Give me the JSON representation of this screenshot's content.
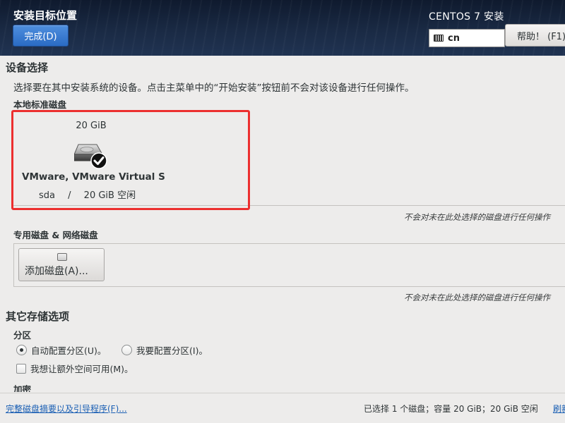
{
  "header": {
    "title": "安装目标位置",
    "done_label": "完成(D)",
    "product": "CENTOS 7 安装",
    "keyboard_layout": "cn",
    "help_label": "帮助！ (F1)"
  },
  "device_selection": {
    "heading": "设备选择",
    "description": "选择要在其中安装系统的设备。点击主菜单中的“开始安装”按钮前不会对该设备进行任何操作。",
    "local_disks_heading": "本地标准磁盘",
    "disks": [
      {
        "size": "20 GiB",
        "name": "VMware, VMware Virtual S",
        "device": "sda",
        "separator": "/",
        "free": "20 GiB 空闲",
        "selected": true
      }
    ],
    "local_note": "不会对未在此处选择的磁盘进行任何操作",
    "special_heading": "专用磁盘 & 网络磁盘",
    "add_disk_label": "添加磁盘(A)...",
    "special_note": "不会对未在此处选择的磁盘进行任何操作"
  },
  "other_storage": {
    "heading": "其它存储选项",
    "partition_heading": "分区",
    "auto_partition_label": "自动配置分区(U)。",
    "manual_partition_label": "我要配置分区(I)。",
    "auto_partition_selected": true,
    "extra_space_label": "我想让额外空间可用(M)。",
    "extra_space_checked": false,
    "encryption_heading": "加密"
  },
  "footer": {
    "summary_link": "完整磁盘摘要以及引导程序(F)...",
    "status": "已选择 1 个磁盘；容量 20 GiB；20 GiB 空闲",
    "refresh_link": "刷新(R)"
  },
  "colors": {
    "header_bg": "#1a2a44",
    "primary_button": "#2a6bc4",
    "highlight_frame": "#ec2f2f",
    "link": "#1a5fb4"
  }
}
